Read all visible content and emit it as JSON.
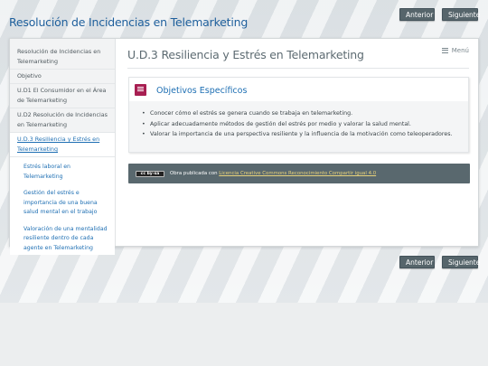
{
  "site_title": "Resolución de Incidencias en Telemarketing",
  "nav": {
    "prev_label": "Anterior",
    "next_label": "Siguiente"
  },
  "sidebar": {
    "items": [
      {
        "label": "Resolución de Incidencias en Telemarketing"
      },
      {
        "label": "Objetivo"
      },
      {
        "label": "U.D1 El Consumidor en el Área de Telemarketing"
      },
      {
        "label": "U.D2 Resolución de Incidencias en Telemarketing"
      },
      {
        "label": "U.D.3 Resiliencia y Estrés en Telemarketing"
      }
    ],
    "subitems": [
      {
        "label": "Estrés laboral en Telemarketing"
      },
      {
        "label": "Gestión del estrés e importancia de una buena salud mental en el trabajo"
      },
      {
        "label": "Valoración de una mentalidad resiliente dentro de cada agente en Telemarketing"
      }
    ]
  },
  "page": {
    "title": "U.D.3 Resiliencia y Estrés en Telemarketing",
    "menu_label": "Menú"
  },
  "objectives": {
    "title": "Objetivos Específicos",
    "items": [
      "Conocer cómo el estrés se genera cuando se trabaja en telemarketing.",
      "Aplicar adecuadamente métodos de gestión del estrés por medio y valorar la salud mental.",
      "Valorar la importancia de una perspectiva resiliente y la influencia de la motivación como teleoperadores."
    ]
  },
  "license": {
    "badge": "cc by-sa",
    "text": "Obra publicada con ",
    "link_text": "Licencia Creative Commons Reconocimiento Compartir igual 4.0"
  }
}
